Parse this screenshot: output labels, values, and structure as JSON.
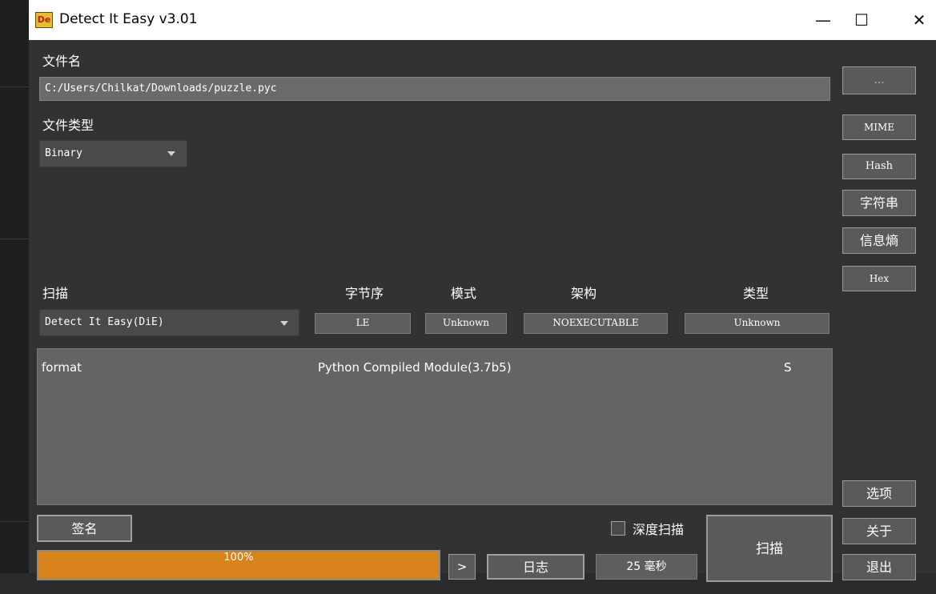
{
  "window": {
    "title": "Detect It Easy v3.01",
    "logo_text": "De",
    "minimize_glyph": "—",
    "maximize_glyph": "☐",
    "close_glyph": "✕"
  },
  "file": {
    "label": "文件名",
    "path": "C:/Users/Chilkat/Downloads/puzzle.pyc",
    "browse_label": "..."
  },
  "filetype": {
    "label": "文件类型",
    "selected": "Binary"
  },
  "scan": {
    "label": "扫描",
    "engine": "Detect It Easy(DiE)",
    "endianness_label": "字节序",
    "endianness_value": "LE",
    "mode_label": "模式",
    "mode_value": "Unknown",
    "arch_label": "架构",
    "arch_value": "NOEXECUTABLE",
    "type_label": "类型",
    "type_value": "Unknown"
  },
  "results": [
    {
      "key": "format",
      "value": "Python Compiled Module(3.7b5)",
      "flag": "S"
    }
  ],
  "side_buttons": {
    "mime": "MIME",
    "hash": "Hash",
    "strings": "字符串",
    "entropy": "信息熵",
    "hex": "Hex",
    "options": "选项",
    "about": "关于",
    "exit": "退出"
  },
  "bottom": {
    "signatures_label": "签名",
    "progress_text": "100%",
    "progress_value": 100,
    "arrow_glyph": ">",
    "log_label": "日志",
    "time_text": "25 毫秒",
    "deep_scan_label": "深度扫描",
    "scan_button_label": "扫描"
  },
  "colors": {
    "progress_fill": "#d9831d",
    "window_bg": "#323232",
    "panel_bg": "#646464"
  }
}
